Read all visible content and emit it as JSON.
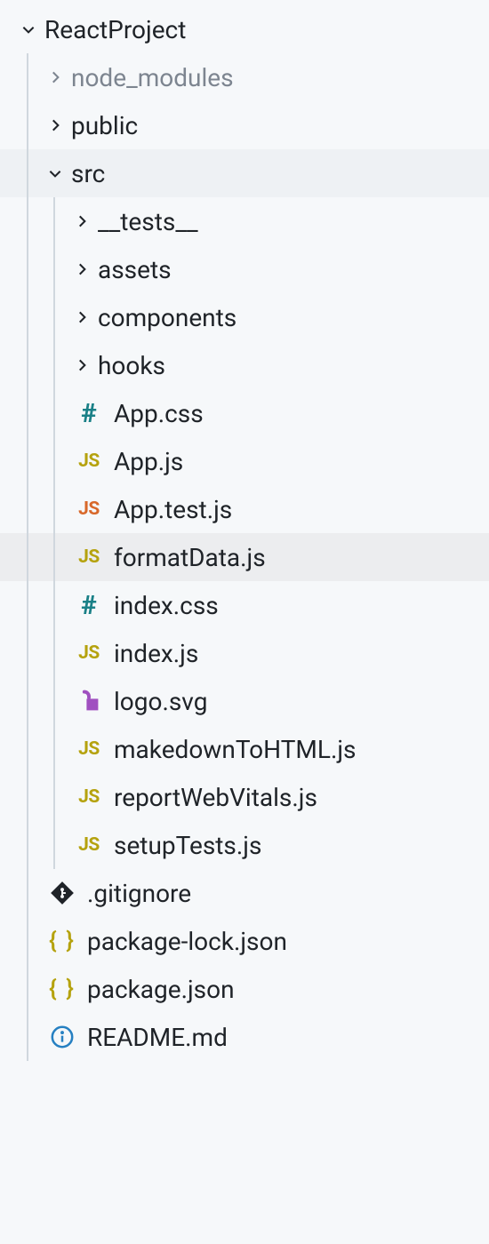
{
  "tree": {
    "root": "ReactProject",
    "node_modules": "node_modules",
    "public": "public",
    "src": "src",
    "tests": "__tests__",
    "assets": "assets",
    "components": "components",
    "hooks": "hooks",
    "app_css": "App.css",
    "app_js": "App.js",
    "app_test_js": "App.test.js",
    "formatdata_js": "formatData.js",
    "index_css": "index.css",
    "index_js": "index.js",
    "logo_svg": "logo.svg",
    "markdown_js": "makedownToHTML.js",
    "reportwebvitals_js": "reportWebVitals.js",
    "setuptests_js": "setupTests.js",
    "gitignore": ".gitignore",
    "package_lock": "package-lock.json",
    "package_json": "package.json",
    "readme": "README.md"
  },
  "icons": {
    "js": "JS",
    "hash": "#",
    "json": "{ }"
  }
}
